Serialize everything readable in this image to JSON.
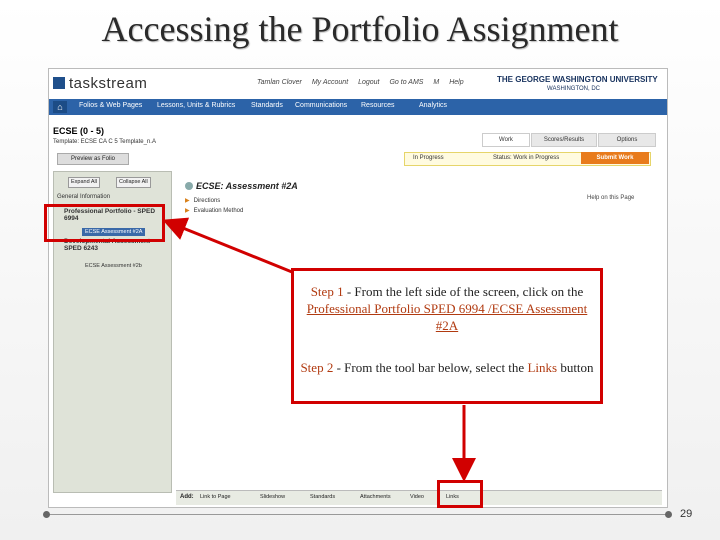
{
  "slide": {
    "title": "Accessing the Portfolio Assignment",
    "page_number": "29"
  },
  "app": {
    "logo": "taskstream",
    "user_links": [
      "Tamlan Clover",
      "My Account",
      "Logout",
      "Go to AMS",
      "M",
      "Help"
    ],
    "university": "THE GEORGE WASHINGTON UNIVERSITY",
    "university_sub": "WASHINGTON, DC",
    "nav": [
      "Folios & Web Pages",
      "Lessons, Units & Rubrics",
      "Standards",
      "Communications",
      "Resources",
      "Analytics"
    ],
    "doc_title": "ECSE (0 - 5)",
    "template": "Template: ECSE CA C 5 Template_n.A",
    "tabs": [
      "Work",
      "Scores/Results",
      "Options"
    ],
    "preview_button": "Preview as Folio",
    "toolbar_text": "In Progress",
    "toolbar_status": "Status: Work in Progress",
    "submit_button": "Submit Work",
    "sidebar": {
      "expand": "Expand All",
      "collapse": "Collapse All",
      "section": "General Information",
      "items": [
        {
          "label": "Professional Portfolio - SPED 6994",
          "sub": "ECSE Assessment #2A"
        },
        {
          "label": "Developmental Assessment - SPED 6243",
          "sub": "ECSE Assessment #2b"
        }
      ]
    },
    "main": {
      "heading": "ECSE: Assessment #2A",
      "rows": [
        "Directions",
        "Evaluation Method"
      ],
      "help": "Help on this Page"
    },
    "addbar": {
      "label": "Add:",
      "buttons": [
        "Link to Page",
        "Slideshow",
        "Standards",
        "Attachments",
        "Video",
        "Links"
      ]
    }
  },
  "callout": {
    "step1_label": "Step 1",
    "step1_text": " - From the left side of the screen, click on the ",
    "step1_link": "Professional Portfolio SPED 6994 /ECSE Assessment #2A",
    "step2_label": "Step 2",
    "step2_text": " - From the tool bar below, select the ",
    "step2_keyword": "Links",
    "step2_end": " button"
  },
  "colors": {
    "highlight": "#d10000",
    "nav_bar": "#2c63a8",
    "submit": "#e87b1c"
  }
}
